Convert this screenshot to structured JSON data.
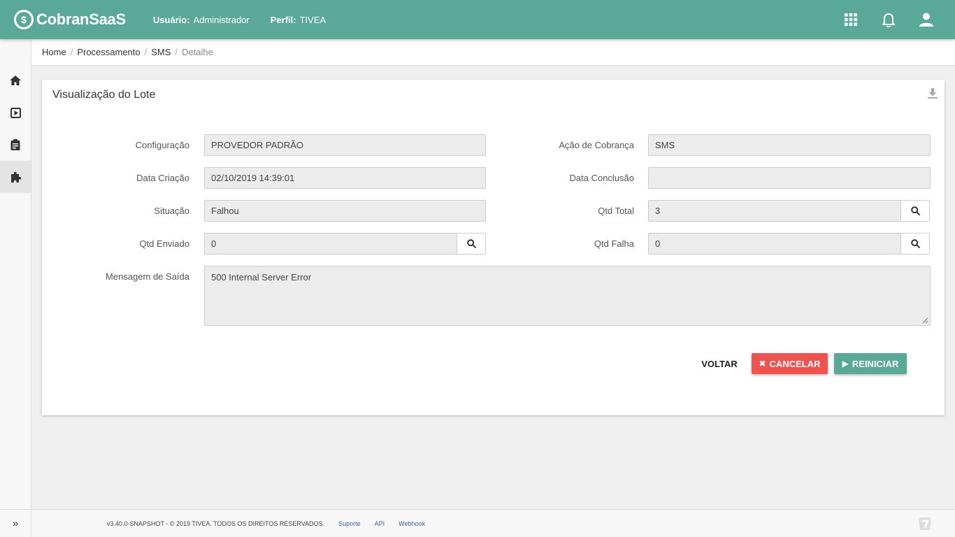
{
  "header": {
    "brand": "CobranSaaS",
    "user_label": "Usuário:",
    "user_value": "Administrador",
    "profile_label": "Perfil:",
    "profile_value": "TIVEA",
    "icons": [
      "apps-grid-icon",
      "bell-icon",
      "user-icon"
    ]
  },
  "sidebar": {
    "items": [
      "home-icon",
      "play-box-icon",
      "clipboard-icon",
      "puzzle-icon"
    ],
    "active_index": 3,
    "expand_icon": "»"
  },
  "breadcrumb": {
    "items": [
      "Home",
      "Processamento",
      "SMS"
    ],
    "current": "Detalhe",
    "separator": "/"
  },
  "card": {
    "title": "Visualização do Lote",
    "fields": {
      "configuracao": {
        "label": "Configuração",
        "value": "PROVEDOR PADRÃO"
      },
      "acao_cobranca": {
        "label": "Ação de Cobrança",
        "value": "SMS"
      },
      "data_criacao": {
        "label": "Data Criação",
        "value": "02/10/2019 14:39:01"
      },
      "data_conclusao": {
        "label": "Data Conclusão",
        "value": ""
      },
      "situacao": {
        "label": "Situação",
        "value": "Falhou"
      },
      "qtd_total": {
        "label": "Qtd Total",
        "value": "3"
      },
      "qtd_enviado": {
        "label": "Qtd Enviado",
        "value": "0"
      },
      "qtd_falha": {
        "label": "Qtd Falha",
        "value": "0"
      },
      "mensagem_saida": {
        "label": "Mensagem de Saída",
        "value": "500 Internal Server Error"
      }
    },
    "buttons": {
      "voltar": "VOLTAR",
      "cancelar": "CANCELAR",
      "reiniciar": "REINICIAR"
    }
  },
  "footer": {
    "copyright": "v3.40.0-SNAPSHOT - © 2019 TIVEA. TODOS OS DIREITOS RESERVADOS.",
    "links": [
      "Suporte",
      "API",
      "Webhook"
    ]
  },
  "colors": {
    "primary": "#5aa898",
    "danger": "#ef5350",
    "link": "#3a66a8"
  }
}
